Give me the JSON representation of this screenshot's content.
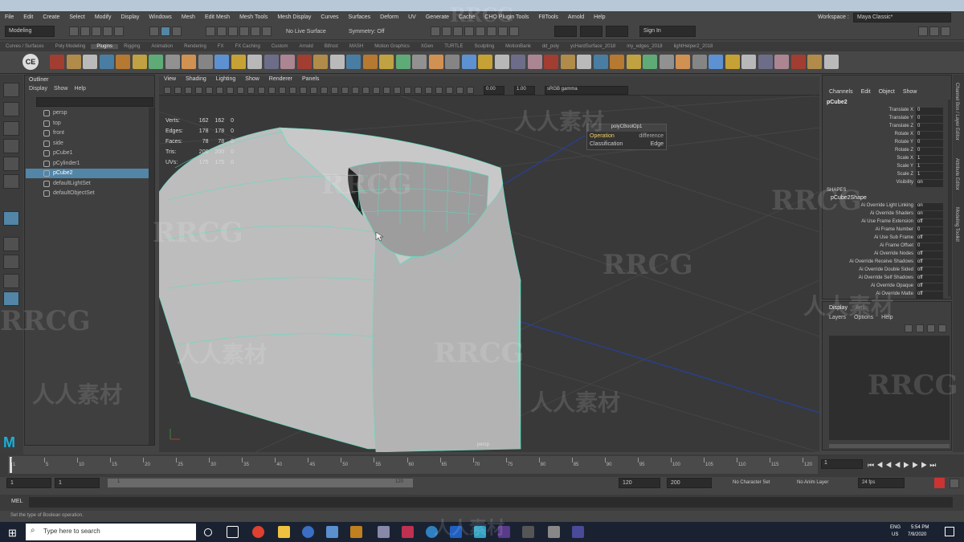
{
  "app": {
    "menus": [
      "File",
      "Edit",
      "Create",
      "Select",
      "Modify",
      "Display",
      "Windows",
      "Mesh",
      "Edit Mesh",
      "Mesh Tools",
      "Mesh Display",
      "Curves",
      "Surfaces",
      "Deform",
      "UV",
      "Generate",
      "Cache",
      "",
      "Arnold",
      "Help"
    ],
    "menu_extra": [
      "CHO Plugin Tools",
      "F8Tools"
    ]
  },
  "statusline": {
    "mode": "Modeling",
    "live_surface": "No Live Surface",
    "symmetry": "Symmetry: Off",
    "sign_in": "Sign In",
    "workspace_label": "Workspace :",
    "workspace_value": "Maya Classic*"
  },
  "shelf_tabs": [
    "Curves / Surfaces",
    "Poly Modeling",
    "Plugins",
    "Rigging",
    "Animation",
    "Rendering",
    "FX",
    "FX Caching",
    "Custom",
    "Arnold",
    "Bifrost",
    "MASH",
    "Motion Graphics",
    "XGen",
    "TURTLE",
    "Sculpting",
    "MotionBank",
    "dd_poly",
    "ycHardSurface_2018",
    "my_edges_2018",
    "lightHelper2_2018"
  ],
  "shelf_active": "Plugins",
  "outliner": {
    "title": "Outliner",
    "menus": [
      "Display",
      "Show",
      "Help"
    ],
    "search": "",
    "items": [
      "persp",
      "top",
      "front",
      "side",
      "pCube1",
      "pCylinder1",
      "pCube2",
      "defaultLightSet",
      "defaultObjectSet"
    ],
    "selected": "pCube2"
  },
  "viewport": {
    "menus": [
      "View",
      "Shading",
      "Lighting",
      "Show",
      "Renderer",
      "Panels"
    ],
    "field1": "0.00",
    "field2": "1.00",
    "colorspace": "sRGB gamma",
    "camera": "persp",
    "hud": [
      [
        "Verts:",
        "162",
        "162",
        "0"
      ],
      [
        "Edges:",
        "178",
        "178",
        "0"
      ],
      [
        "Faces:",
        "78",
        "78",
        "0"
      ],
      [
        "Tris:",
        "200",
        "200",
        "0"
      ],
      [
        "UVs:",
        "175",
        "175",
        "0"
      ]
    ],
    "bool_panel": {
      "title": "polyCBoolOp1",
      "operation_label": "Operation",
      "operation_value": "difference",
      "classification_label": "Classification",
      "classification_value": "Edge"
    }
  },
  "channelbox": {
    "menus": [
      "Channels",
      "Edit",
      "Object",
      "Show"
    ],
    "object": "pCube2",
    "attrs": [
      [
        "Translate X",
        "0"
      ],
      [
        "Translate Y",
        "0"
      ],
      [
        "Translate Z",
        "0"
      ],
      [
        "Rotate X",
        "0"
      ],
      [
        "Rotate Y",
        "0"
      ],
      [
        "Rotate Z",
        "0"
      ],
      [
        "Scale X",
        "1"
      ],
      [
        "Scale Y",
        "1"
      ],
      [
        "Scale Z",
        "1"
      ],
      [
        "Visibility",
        "on"
      ]
    ],
    "shapes_header": "SHAPES",
    "shape_name": "pCube2Shape",
    "shape_attrs": [
      [
        "Ai Override Light Linking",
        "on"
      ],
      [
        "Ai Override Shaders",
        "on"
      ],
      [
        "Ai Use Frame Extension",
        "off"
      ],
      [
        "Ai Frame Number",
        "0"
      ],
      [
        "Ai Use Sub Frame",
        "off"
      ],
      [
        "Ai Frame Offset",
        "0"
      ],
      [
        "Ai Override Nodes",
        "off"
      ],
      [
        "Ai Override Receive Shadows",
        "off"
      ],
      [
        "Ai Override Double Sided",
        "off"
      ],
      [
        "Ai Override Self Shadows",
        "off"
      ],
      [
        "Ai Override Opaque",
        "off"
      ],
      [
        "Ai Override Matte",
        "off"
      ]
    ]
  },
  "layers": {
    "tabs": [
      "Display",
      "Anim"
    ],
    "menus": [
      "Layers",
      "Options",
      "Help"
    ]
  },
  "side_tabs": [
    "Channel Box / Layer Editor",
    "Attribute Editor",
    "Modeling Toolkit"
  ],
  "timeline": {
    "ticks": [
      "1",
      "5",
      "10",
      "15",
      "20",
      "25",
      "30",
      "35",
      "40",
      "45",
      "50",
      "55",
      "60",
      "65",
      "70",
      "75",
      "80",
      "85",
      "90",
      "95",
      "100",
      "105",
      "110",
      "115",
      "120"
    ],
    "current_frame": "1"
  },
  "range": {
    "start": "1",
    "inner_start": "1",
    "slider_start": "1",
    "slider_end": "120",
    "end": "120",
    "outer_end": "200",
    "char_set": "No Character Set",
    "anim_layer": "No Anim Layer",
    "fps": "24 fps"
  },
  "cmdline": {
    "label": "MEL",
    "value": ""
  },
  "helpline": "Set the type of Boolean operation.",
  "taskbar": {
    "search": "Type here to search",
    "lang": "ENG",
    "region": "US",
    "time": "5:54 PM",
    "date": "7/9/2020"
  },
  "watermarks": [
    "RRCG",
    "人人素材"
  ],
  "colors": {
    "selection": "#5285a6",
    "mesh": "#bdbdbd",
    "wire": "#55e0c0",
    "grid_axis": "#2a3f8a"
  }
}
